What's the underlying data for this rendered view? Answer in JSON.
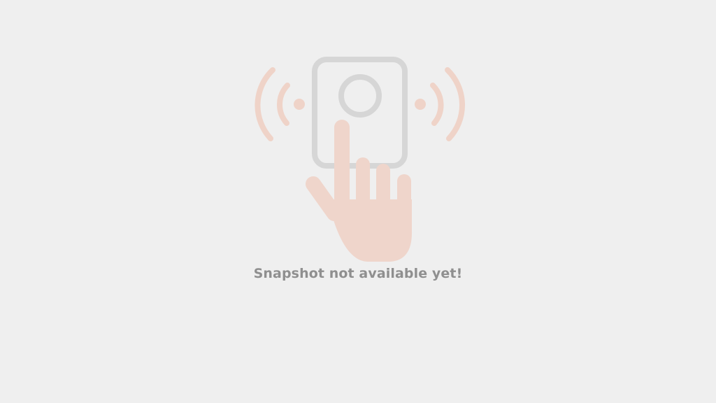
{
  "placeholder": {
    "message": "Snapshot not available yet!",
    "icon": "doorbell-press-icon",
    "colors": {
      "background": "#efefef",
      "device": "#d6d6d6",
      "hand": "#efd5cb",
      "waves": "#efd3c8",
      "text": "#8f8f8f"
    }
  }
}
